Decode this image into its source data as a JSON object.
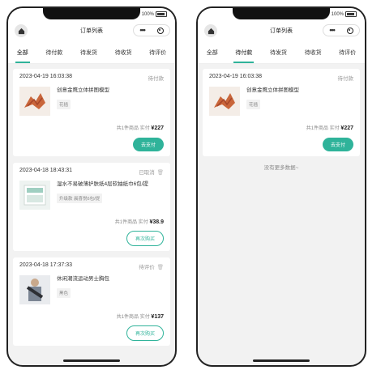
{
  "status": {
    "battery": "100%"
  },
  "nav": {
    "title": "订单列表"
  },
  "tabs": [
    "全部",
    "待付款",
    "待发货",
    "待收货",
    "待评价"
  ],
  "left": {
    "orders": [
      {
        "time": "2023-04-19 16:03:38",
        "status": "待付款",
        "name": "创意金鹰立体拼图模型",
        "sku": "花插",
        "count_text": "共1件商品",
        "paid_label": "实付",
        "amount": "¥227",
        "button": "去支付"
      },
      {
        "time": "2023-04-18 18:43:31",
        "status": "已取消",
        "name": "湿水不易破薄护肤纸4层软抽纸巾6包/提",
        "sku": "升级款 晨喜悦6包/提",
        "count_text": "共1件商品",
        "paid_label": "实付",
        "amount": "¥38.9",
        "button": "再次购买"
      },
      {
        "time": "2023-04-18 17:37:33",
        "status": "待评价",
        "name": "休闲潮流运动男士胸包",
        "sku": "黑色",
        "count_text": "共1件商品",
        "paid_label": "实付",
        "amount": "¥137",
        "button": "再次购买"
      }
    ]
  },
  "right": {
    "orders": [
      {
        "time": "2023-04-19 16:03:38",
        "status": "待付款",
        "name": "创意金鹰立体拼图模型",
        "sku": "花插",
        "count_text": "共1件商品",
        "paid_label": "实付",
        "amount": "¥227",
        "button": "去支付"
      }
    ],
    "no_more": "没有更多数据~"
  },
  "colors": {
    "accent": "#2fb39a",
    "background": "#f2f2f2"
  }
}
